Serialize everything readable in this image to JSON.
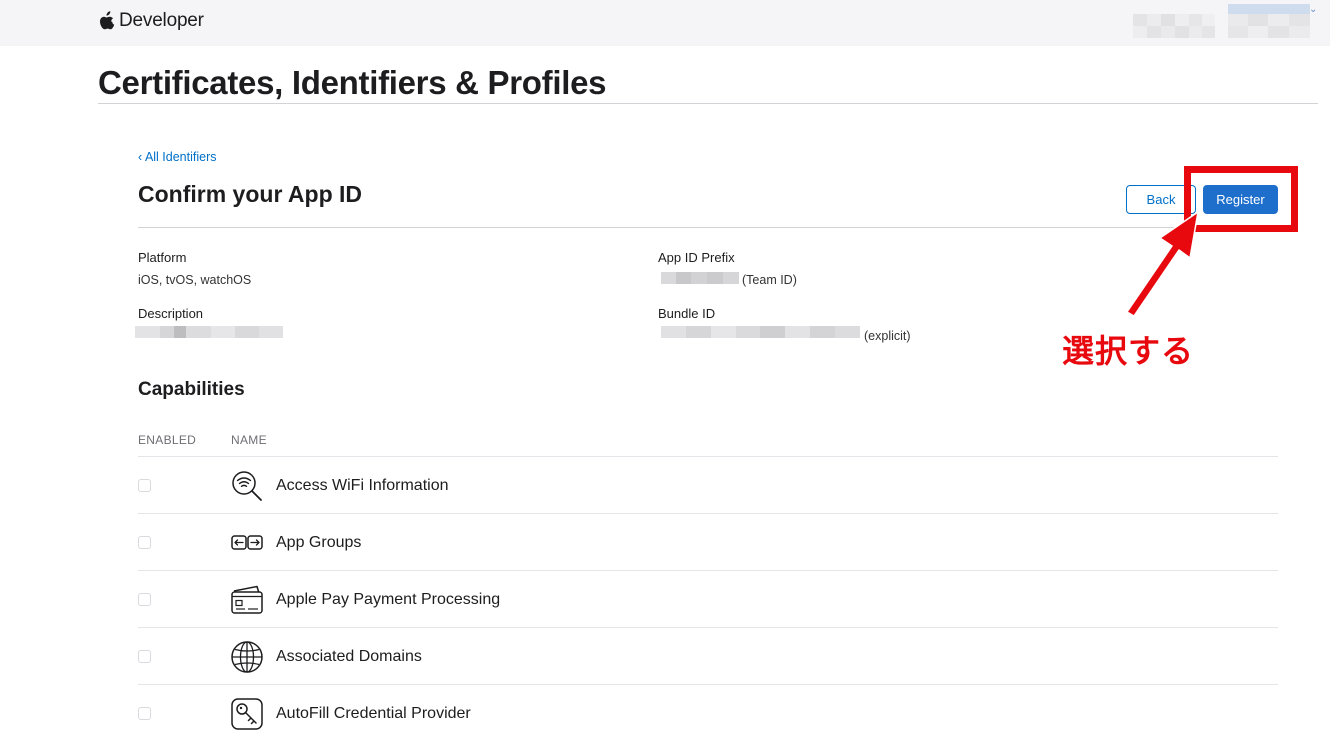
{
  "header": {
    "brand_label": "Developer",
    "logo_icon": "apple-logo-icon",
    "account_chevron": "⌄"
  },
  "page": {
    "title": "Certificates, Identifiers & Profiles"
  },
  "section": {
    "back_link": "‹ All Identifiers",
    "title": "Confirm your App ID",
    "back_button": "Back",
    "register_button": "Register"
  },
  "details": {
    "platform_label": "Platform",
    "platform_value": "iOS, tvOS, watchOS",
    "description_label": "Description",
    "prefix_label": "App ID Prefix",
    "prefix_suffix": "(Team ID)",
    "bundle_label": "Bundle ID",
    "bundle_suffix": "(explicit)"
  },
  "capabilities": {
    "title": "Capabilities",
    "col_enabled": "ENABLED",
    "col_name": "NAME",
    "items": [
      {
        "name": "Access WiFi Information",
        "icon": "wifi-search-icon",
        "enabled": false
      },
      {
        "name": "App Groups",
        "icon": "app-groups-icon",
        "enabled": false
      },
      {
        "name": "Apple Pay Payment Processing",
        "icon": "payment-card-icon",
        "enabled": false
      },
      {
        "name": "Associated Domains",
        "icon": "globe-icon",
        "enabled": false
      },
      {
        "name": "AutoFill Credential Provider",
        "icon": "key-icon",
        "enabled": false
      }
    ]
  },
  "annotation": {
    "text": "選択する",
    "color": "#e8090f"
  },
  "colors": {
    "link": "#0070c9",
    "primary_button": "#1e6fcb",
    "topbar": "#f5f5f7"
  }
}
